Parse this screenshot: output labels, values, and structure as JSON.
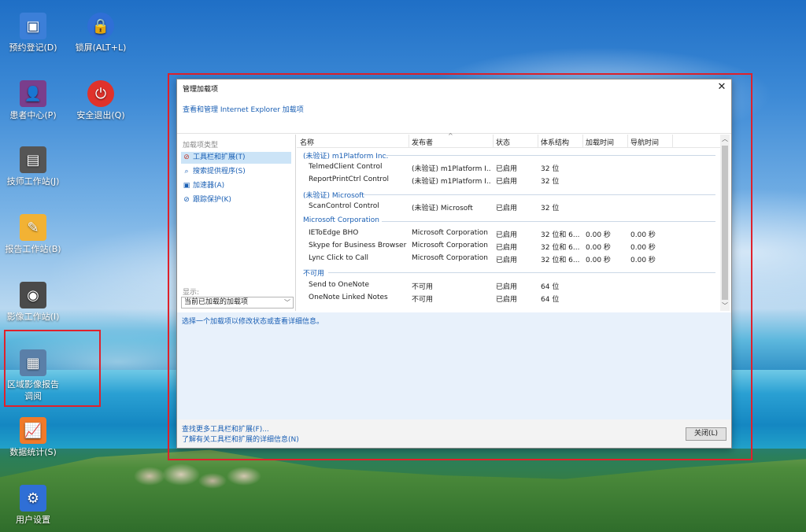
{
  "desktop": {
    "icons": [
      {
        "label": "预约登记(D)",
        "icon": "register-icon",
        "color": "#3c7fd8"
      },
      {
        "label": "锁屏(ALT+L)",
        "icon": "lock-icon",
        "color": "#2f6fd6"
      },
      {
        "label": "患者中心(P)",
        "icon": "patient-icon",
        "color": "#7a3e8c"
      },
      {
        "label": "安全退出(Q)",
        "icon": "power-icon",
        "color": "#e0322b"
      },
      {
        "label": "技师工作站(J)",
        "icon": "technician-icon",
        "color": "#555555"
      },
      {
        "label": "报告工作站(B)",
        "icon": "report-icon",
        "color": "#f2b234"
      },
      {
        "label": "影像工作站(I)",
        "icon": "imaging-icon",
        "color": "#4a4a4a"
      },
      {
        "label": "区域影像报告调阅",
        "icon": "regional-report-icon",
        "color": "#5a7fa8"
      },
      {
        "label": "数据统计(S)",
        "icon": "chart-icon",
        "color": "#f07a2a"
      },
      {
        "label": "用户设置",
        "icon": "user-settings-icon",
        "color": "#2f6fd6"
      }
    ]
  },
  "dialog": {
    "title": "管理加载项",
    "close_glyph": "✕",
    "subtitle": "查看和管理 Internet Explorer 加载项",
    "left": {
      "heading": "加载项类型",
      "items": [
        {
          "label": "工具栏和扩展(T)",
          "icon": "toolbar-icon"
        },
        {
          "label": "搜索提供程序(S)",
          "icon": "search-icon"
        },
        {
          "label": "加速器(A)",
          "icon": "accelerator-icon"
        },
        {
          "label": "跟踪保护(K)",
          "icon": "tracking-protection-icon"
        }
      ],
      "show_label": "显示:",
      "show_value": "当前已加载的加载项"
    },
    "columns": [
      "名称",
      "发布者",
      "状态",
      "体系结构",
      "加载时间",
      "导航时间"
    ],
    "groups": [
      {
        "name": "(未验证) m1Platform Inc.",
        "rows": [
          {
            "name": "TelmedClient Control",
            "publisher": "(未验证) m1Platform I...",
            "status": "已启用",
            "arch": "32 位",
            "load": "",
            "nav": ""
          },
          {
            "name": "ReportPrintCtrl Control",
            "publisher": "(未验证) m1Platform I...",
            "status": "已启用",
            "arch": "32 位",
            "load": "",
            "nav": ""
          }
        ]
      },
      {
        "name": "(未验证) Microsoft",
        "rows": [
          {
            "name": "ScanControl Control",
            "publisher": "(未验证) Microsoft",
            "status": "已启用",
            "arch": "32 位",
            "load": "",
            "nav": ""
          }
        ]
      },
      {
        "name": "Microsoft Corporation",
        "rows": [
          {
            "name": "IEToEdge BHO",
            "publisher": "Microsoft Corporation",
            "status": "已启用",
            "arch": "32 位和 6...",
            "load": "0.00 秒",
            "nav": "0.00 秒"
          },
          {
            "name": "Skype for Business Browser ...",
            "publisher": "Microsoft Corporation",
            "status": "已启用",
            "arch": "32 位和 6...",
            "load": "0.00 秒",
            "nav": "0.00 秒"
          },
          {
            "name": "Lync Click to Call",
            "publisher": "Microsoft Corporation",
            "status": "已启用",
            "arch": "32 位和 6...",
            "load": "0.00 秒",
            "nav": "0.00 秒"
          }
        ]
      },
      {
        "name": "不可用",
        "rows": [
          {
            "name": "Send to OneNote",
            "publisher": "不可用",
            "status": "已启用",
            "arch": "64 位",
            "load": "",
            "nav": ""
          },
          {
            "name": "OneNote Linked Notes",
            "publisher": "不可用",
            "status": "已启用",
            "arch": "64 位",
            "load": "",
            "nav": ""
          }
        ]
      }
    ],
    "hint": "选择一个加载项以修改状态或查看详细信息。",
    "footer_links": [
      "查找更多工具栏和扩展(F)...",
      "了解有关工具栏和扩展的详细信息(N)"
    ],
    "close_button": "关闭(L)"
  }
}
